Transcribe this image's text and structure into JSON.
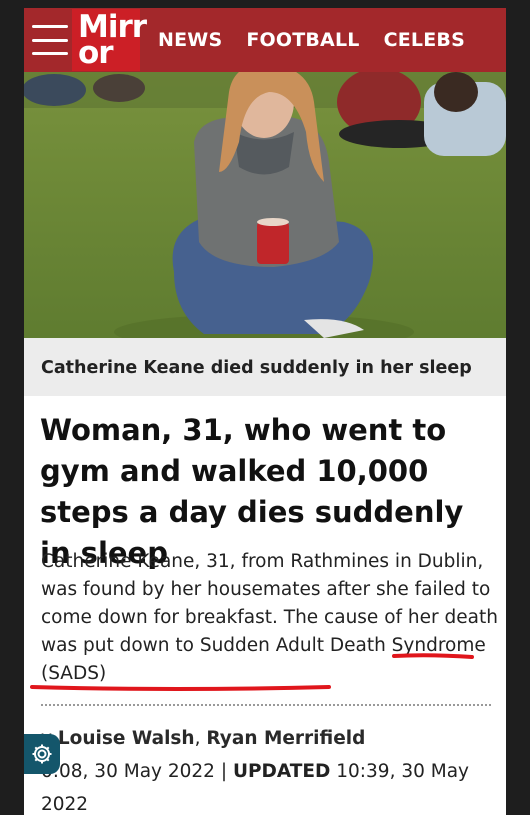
{
  "header": {
    "logo_line1": "Mirr",
    "logo_line2": "or",
    "nav": [
      "NEWS",
      "FOOTBALL",
      "CELEBS"
    ]
  },
  "caption": "Catherine Keane died suddenly in her sleep",
  "headline": "Woman, 31, who went to gym and walked 10,000 steps a day dies suddenly in sleep",
  "standfirst_main": "Catherine Keane, 31, from Rathmines in Dublin, was found by her housemates after she failed to come down for breakfast. The cause of her death was put down to ",
  "standfirst_highlight": "Sudden Adult Death Syndrome (SADS)",
  "byline": {
    "prefix": "y",
    "author1": "Louise Walsh",
    "author2": "Ryan Merrifield",
    "published": "0:08, 30 May 2022",
    "updated_label": "UPDATED",
    "updated": "10:39, 30 May 2022"
  },
  "colors": {
    "brand": "#a3282b",
    "logo": "#cc1f26",
    "annotation_underline": "#e0161c",
    "settings_button": "#14566b"
  },
  "icons": [
    "hamburger-menu-icon",
    "gear-icon"
  ]
}
